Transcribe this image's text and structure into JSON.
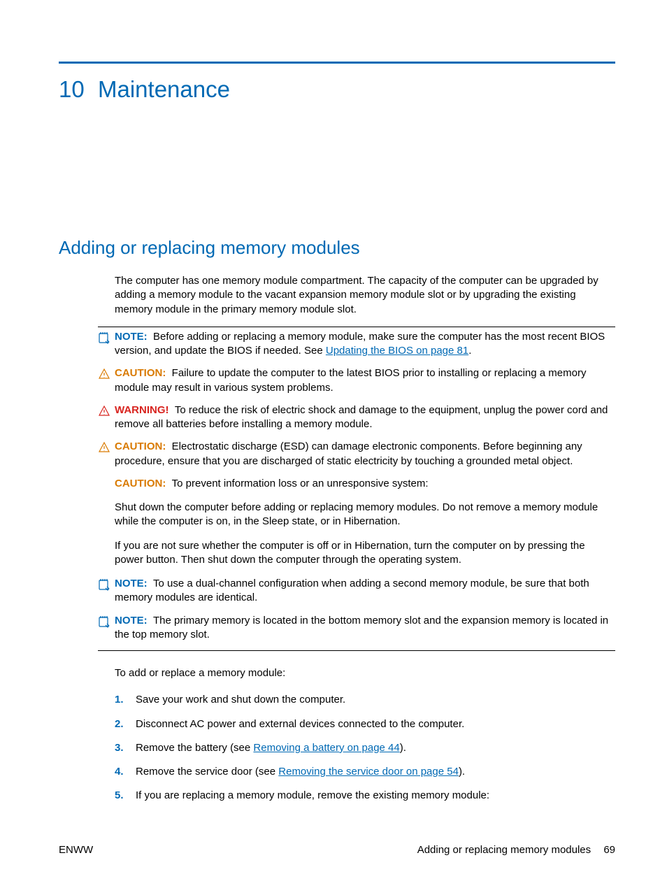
{
  "chapter": {
    "number": "10",
    "title": "Maintenance"
  },
  "section": {
    "title": "Adding or replacing memory modules"
  },
  "intro": "The computer has one memory module compartment. The capacity of the computer can be upgraded by adding a memory module to the vacant expansion memory module slot or by upgrading the existing memory module in the primary memory module slot.",
  "callouts": {
    "note1": {
      "label": "NOTE:",
      "text_a": "Before adding or replacing a memory module, make sure the computer has the most recent BIOS version, and update the BIOS if needed. See ",
      "link": "Updating the BIOS on page 81",
      "text_b": "."
    },
    "caution1": {
      "label": "CAUTION:",
      "text": "Failure to update the computer to the latest BIOS prior to installing or replacing a memory module may result in various system problems."
    },
    "warning1": {
      "label": "WARNING!",
      "text": "To reduce the risk of electric shock and damage to the equipment, unplug the power cord and remove all batteries before installing a memory module."
    },
    "caution2": {
      "label": "CAUTION:",
      "text": "Electrostatic discharge (ESD) can damage electronic components. Before beginning any procedure, ensure that you are discharged of static electricity by touching a grounded metal object."
    },
    "caution3": {
      "label": "CAUTION:",
      "text": "To prevent information loss or an unresponsive system:"
    },
    "caution3_p1": "Shut down the computer before adding or replacing memory modules. Do not remove a memory module while the computer is on, in the Sleep state, or in Hibernation.",
    "caution3_p2": "If you are not sure whether the computer is off or in Hibernation, turn the computer on by pressing the power button. Then shut down the computer through the operating system.",
    "note2": {
      "label": "NOTE:",
      "text": "To use a dual-channel configuration when adding a second memory module, be sure that both memory modules are identical."
    },
    "note3": {
      "label": "NOTE:",
      "text": "The primary memory is located in the bottom memory slot and the expansion memory is located in the top memory slot."
    }
  },
  "lead": "To add or replace a memory module:",
  "steps": [
    {
      "n": "1.",
      "text": "Save your work and shut down the computer."
    },
    {
      "n": "2.",
      "text": "Disconnect AC power and external devices connected to the computer."
    },
    {
      "n": "3.",
      "text_a": "Remove the battery (see ",
      "link": "Removing a battery on page 44",
      "text_b": ")."
    },
    {
      "n": "4.",
      "text_a": "Remove the service door (see ",
      "link": "Removing the service door on page 54",
      "text_b": ")."
    },
    {
      "n": "5.",
      "text": "If you are replacing a memory module, remove the existing memory module:"
    }
  ],
  "footer": {
    "left": "ENWW",
    "right": "Adding or replacing memory modules",
    "page": "69"
  }
}
